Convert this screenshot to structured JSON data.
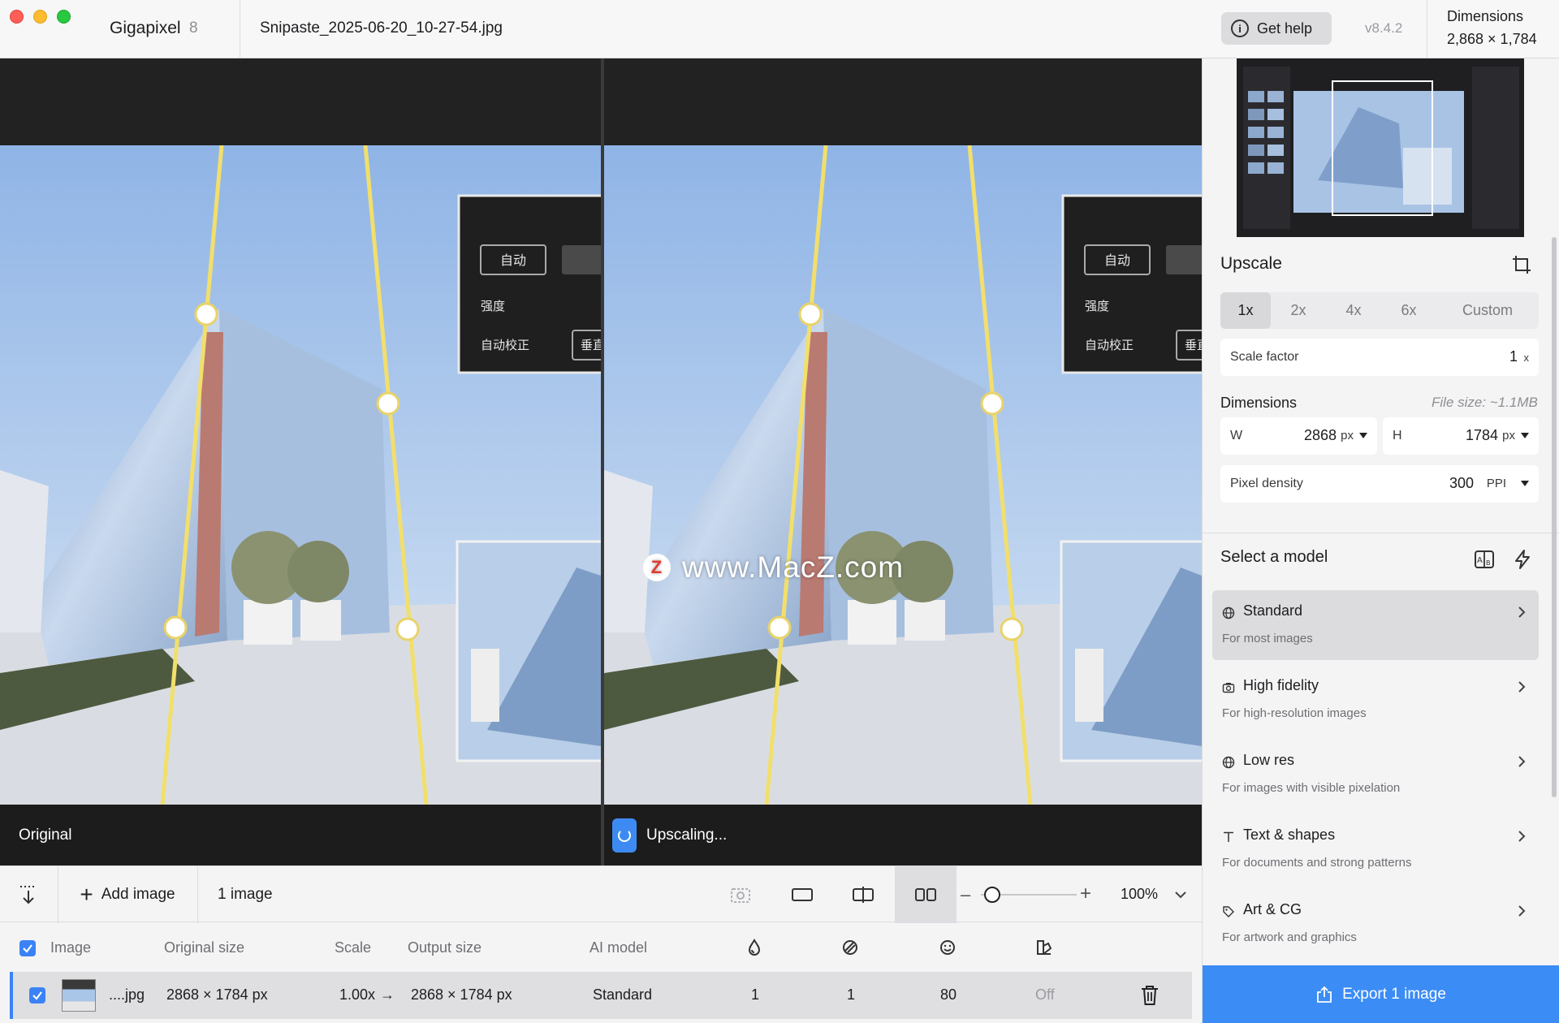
{
  "titlebar": {
    "app_name": "Gigapixel",
    "app_version": "8",
    "file_name": "Snipaste_2025-06-20_10-27-54.jpg",
    "help_label": "Get help",
    "version": "v8.4.2",
    "dimensions_title": "Dimensions",
    "dimensions_value": "2,868 × 1,784"
  },
  "preview": {
    "left_label": "Original",
    "right_label": "Upscaling...",
    "overlay_buttons": {
      "auto": "自动",
      "strength": "强度",
      "auto_correct": "自动校正",
      "vertical": "垂直"
    },
    "watermark": "www.MacZ.com",
    "watermark_badge": "Z"
  },
  "toolbar": {
    "add_image": "Add image",
    "image_count": "1 image",
    "zoom_value": "100%",
    "zoom_fraction": 0.12
  },
  "table": {
    "headers": {
      "image": "Image",
      "original_size": "Original size",
      "scale": "Scale",
      "output_size": "Output size",
      "ai_model": "AI model"
    },
    "row": {
      "name": "....jpg",
      "original_size": "2868 × 1784 px",
      "scale": "1.00x",
      "arrow": "→",
      "output_size": "2868 × 1784 px",
      "ai_model": "Standard",
      "col1": "1",
      "col2": "1",
      "col3": "80",
      "col4": "Off"
    }
  },
  "sidebar": {
    "upscale_title": "Upscale",
    "scale_options": [
      "1x",
      "2x",
      "4x",
      "6x",
      "Custom"
    ],
    "scale_selected": "1x",
    "scale_factor_label": "Scale factor",
    "scale_factor_value": "1",
    "scale_factor_unit": "x",
    "dimensions_label": "Dimensions",
    "file_size": "File size: ~1.1MB",
    "width_label": "W",
    "width_value": "2868",
    "width_unit": "px",
    "height_label": "H",
    "height_value": "1784",
    "height_unit": "px",
    "density_label": "Pixel density",
    "density_value": "300",
    "density_unit": "PPI",
    "model_title": "Select a model",
    "models": [
      {
        "name": "Standard",
        "desc": "For most images",
        "icon": "globe-icon"
      },
      {
        "name": "High fidelity",
        "desc": "For high-resolution images",
        "icon": "camera-icon"
      },
      {
        "name": "Low res",
        "desc": "For images with visible pixelation",
        "icon": "globe-icon"
      },
      {
        "name": "Text & shapes",
        "desc": "For documents and strong patterns",
        "icon": "text-icon"
      },
      {
        "name": "Art & CG",
        "desc": "For artwork and graphics",
        "icon": "tag-icon"
      }
    ],
    "export_label": "Export 1 image"
  },
  "colors": {
    "accent": "#3b8cf5",
    "guide_line": "#f2df6b",
    "background": "#f4f4f5"
  }
}
